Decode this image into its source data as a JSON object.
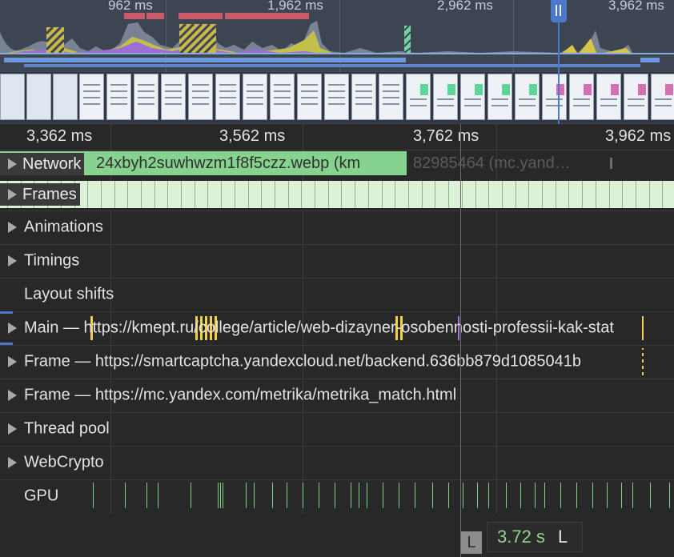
{
  "overview": {
    "labels": [
      "962 ms",
      "1,962 ms",
      "2,962 ms",
      "3,962 ms"
    ]
  },
  "ruler": {
    "labels": [
      "3,362 ms",
      "3,562 ms",
      "3,762 ms",
      "3,962 ms"
    ]
  },
  "network": {
    "label": "Network",
    "request_text": "24xbyh2suwhwzm1f8f5czz.webp (km",
    "request_text2": "82985464 (mc.yand…",
    "color": "#86d38f"
  },
  "tracks": {
    "frames": "Frames",
    "animations": "Animations",
    "timings": "Timings",
    "layout_shifts": "Layout shifts",
    "main": "Main — https://kmept.ru/college/article/web-dizayner-osobennosti-professii-kak-stat",
    "frame1": "Frame — https://smartcaptcha.yandexcloud.net/backend.636bb879d1085041b",
    "frame2": "Frame — https://mc.yandex.com/metrika/metrika_match.html",
    "thread_pool": "Thread pool",
    "webcrypto": "WebCrypto",
    "gpu": "GPU"
  },
  "footer": {
    "l_icon": "L",
    "time_value": "3.72 s",
    "time_suffix": "L"
  },
  "colors": {
    "overview_bg": "#3d4452",
    "accent_blue": "#4b78c8",
    "frames_green": "#ddf1d8",
    "gpu_green": "#7bd37f",
    "task_red": "#c85a6a"
  }
}
